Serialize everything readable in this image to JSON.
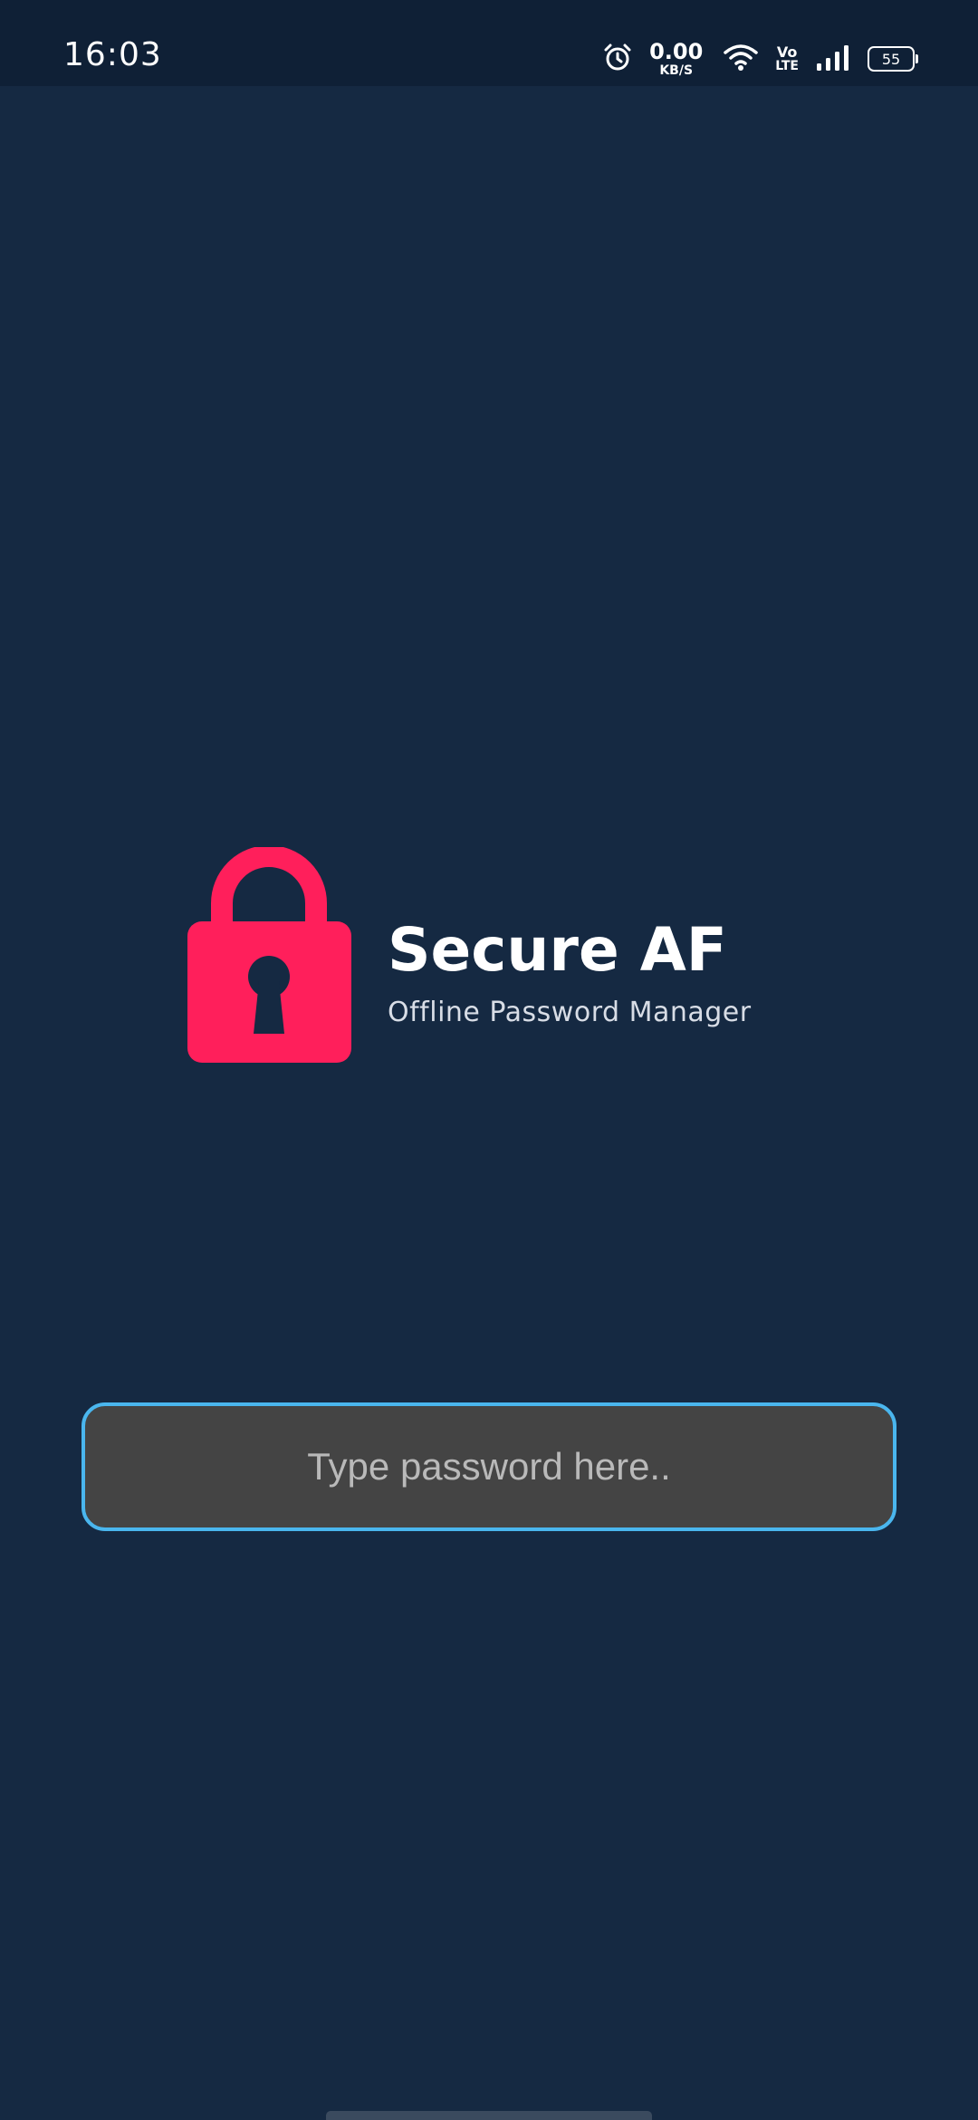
{
  "status_bar": {
    "time": "16:03",
    "net_speed_value": "0.00",
    "net_speed_unit": "KB/S",
    "volte_top": "Vo",
    "volte_bottom": "LTE",
    "battery_level": "55",
    "icons": [
      "alarm-icon",
      "wifi-icon",
      "signal-icon",
      "battery-icon"
    ]
  },
  "app": {
    "title": "Secure AF",
    "subtitle": "Offline Password Manager",
    "logo_icon": "padlock-icon",
    "logo_color": "#ff1f5b"
  },
  "password": {
    "value": "",
    "placeholder": "Type password here.."
  },
  "colors": {
    "background": "#152942",
    "status_bar": "#0f2036",
    "input_border": "#4ab6ee",
    "input_fill": "#444444"
  }
}
